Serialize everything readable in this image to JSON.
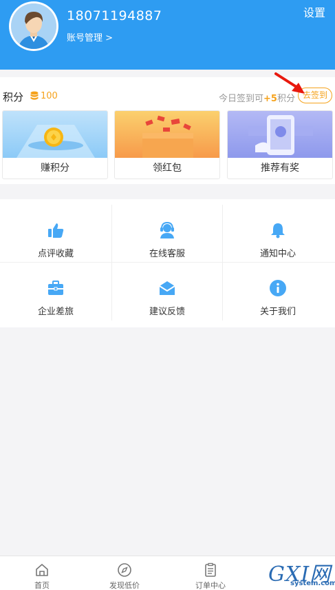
{
  "header": {
    "phone": "18071194887",
    "account_manage": "账号管理 >",
    "settings": "设置"
  },
  "points": {
    "title": "积分",
    "value": "100",
    "sign_prefix": "今日签到可",
    "sign_amount": "+5",
    "sign_suffix": "积分",
    "sign_button": "去签到"
  },
  "cards": [
    {
      "label": "赚积分"
    },
    {
      "label": "领红包"
    },
    {
      "label": "推荐有奖"
    }
  ],
  "menu": [
    {
      "label": "点评收藏",
      "icon": "thumbs-up-icon"
    },
    {
      "label": "在线客服",
      "icon": "customer-service-icon"
    },
    {
      "label": "通知中心",
      "icon": "bell-icon"
    },
    {
      "label": "企业差旅",
      "icon": "briefcase-icon"
    },
    {
      "label": "建议反馈",
      "icon": "envelope-icon"
    },
    {
      "label": "关于我们",
      "icon": "info-icon"
    }
  ],
  "tabbar": [
    {
      "label": "首页",
      "icon": "home-icon"
    },
    {
      "label": "发现低价",
      "icon": "compass-icon"
    },
    {
      "label": "订单中心",
      "icon": "clipboard-icon"
    }
  ],
  "watermark": {
    "big": "GXI网",
    "small": "system.com"
  },
  "colors": {
    "primary": "#2e9cf2",
    "accent": "#f5a21b",
    "icon_blue": "#47a8f5"
  }
}
